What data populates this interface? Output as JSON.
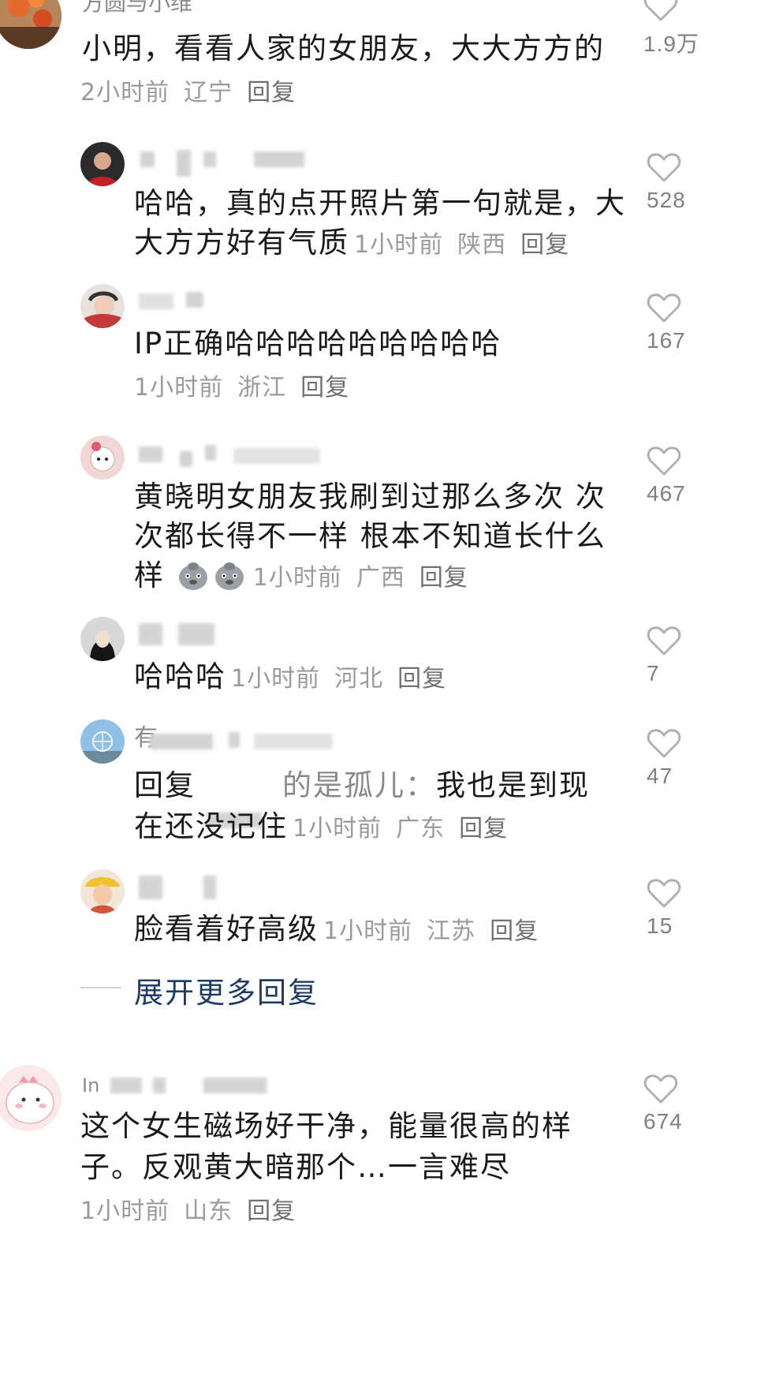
{
  "top_comment": {
    "username": "方圆与小维",
    "text": "小明，看看人家的女朋友，大大方方的",
    "time": "2小时前",
    "location": "辽宁",
    "reply": "回复",
    "likes": "1.9万"
  },
  "replies": [
    {
      "line1": "哈哈，真的点开照片第一句就是，大",
      "line2": "大方方好有气质",
      "time": "1小时前",
      "location": "陕西",
      "reply": "回复",
      "likes": "528"
    },
    {
      "line1": "IP正确哈哈哈哈哈哈哈哈哈",
      "time": "1小时前",
      "location": "浙江",
      "reply": "回复",
      "likes": "167"
    },
    {
      "line1": "黄晓明女朋友我刷到过那么多次 次",
      "line2": "次都长得不一样 根本不知道长什么",
      "line3": "样",
      "time": "1小时前",
      "location": "广西",
      "reply": "回复",
      "likes": "467"
    },
    {
      "line1": "哈哈哈",
      "time": "1小时前",
      "location": "河北",
      "reply": "回复",
      "likes": "7"
    },
    {
      "username_visible": "有",
      "reply_prefix": "回复",
      "reply_target_visible": "的是孤儿：",
      "line1_rest": "我也是到现",
      "line2": "在还没记住",
      "time": "1小时前",
      "location": "广东",
      "reply": "回复",
      "likes": "47"
    },
    {
      "line1": "脸看着好高级",
      "time": "1小时前",
      "location": "江苏",
      "reply": "回复",
      "likes": "15"
    }
  ],
  "expand_more": "展开更多回复",
  "second_comment": {
    "username_visible": "In",
    "line1": "这个女生磁场好干净，能量很高的样",
    "line2": "子。反观黄大暗那个…一言难尽",
    "time": "1小时前",
    "location": "山东",
    "reply": "回复",
    "likes": "674"
  },
  "colors": {
    "text": "#1a1a1a",
    "meta": "#9a9a9a",
    "expand": "#1e3a66",
    "heart": "#b0b0b0"
  },
  "icons": [
    "heart-outline-icon",
    "pigeon-emoji-icon"
  ]
}
